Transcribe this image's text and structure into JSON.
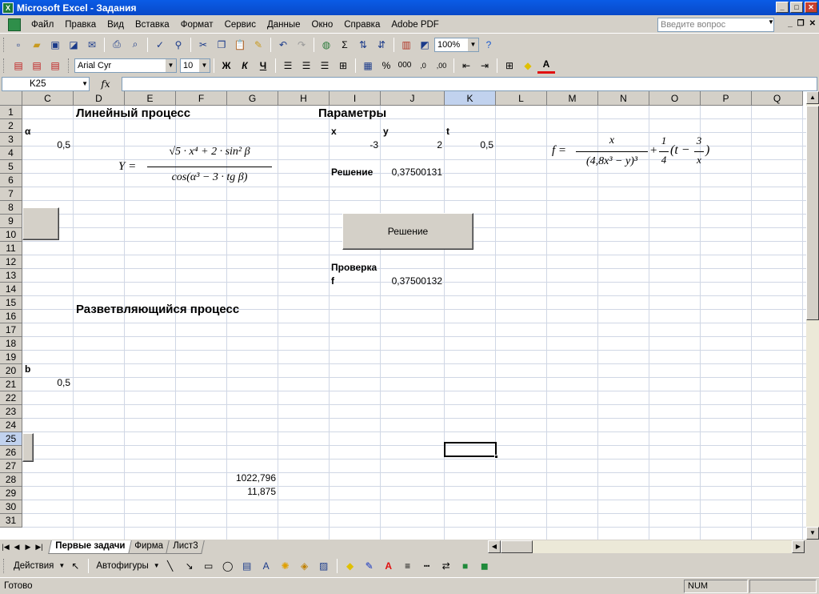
{
  "window": {
    "title": "Microsoft Excel - Задания",
    "app_icon": "excel-icon"
  },
  "menu": {
    "items": [
      "Файл",
      "Правка",
      "Вид",
      "Вставка",
      "Формат",
      "Сервис",
      "Данные",
      "Окно",
      "Справка",
      "Adobe PDF"
    ],
    "help_placeholder": "Введите вопрос"
  },
  "toolbar": {
    "zoom": "100%",
    "font_name": "Arial Cyr",
    "font_size": "10",
    "bold_label": "Ж",
    "italic_label": "К",
    "underline_label": "Ч",
    "percent_label": "%",
    "thousands_label": "000",
    "font_color_label": "A"
  },
  "formula_bar": {
    "name_box": "K25",
    "fx_label": "fx",
    "content": ""
  },
  "grid": {
    "columns": [
      "C",
      "D",
      "E",
      "F",
      "G",
      "H",
      "I",
      "J",
      "K",
      "L",
      "M",
      "N",
      "O",
      "P",
      "Q"
    ],
    "selected_column": "K",
    "rows": [
      "1",
      "2",
      "3",
      "4",
      "5",
      "6",
      "7",
      "8",
      "9",
      "10",
      "11",
      "12",
      "13",
      "14",
      "15",
      "16",
      "17",
      "18",
      "19",
      "20",
      "21",
      "22",
      "23",
      "24",
      "25",
      "26",
      "27",
      "28",
      "29",
      "30",
      "31"
    ],
    "selected_row": "25",
    "selected_cell": "K25"
  },
  "cells": {
    "linear_title": "Линейный процесс",
    "params_title": "Параметры",
    "alpha_label": "α",
    "alpha_value": "0,5",
    "x_label": "x",
    "y_label": "y",
    "t_label": "t",
    "x_value": "-3",
    "y_value": "2",
    "t_value": "0,5",
    "solution_label": "Решение",
    "solution_value": "0,37500131",
    "check_label": "Проверка",
    "f_label": "f",
    "f_value": "0,37500132",
    "branching_title": "Разветвляющийся процесс",
    "b_label": "b",
    "b_value": "0,5",
    "g27_value": "1022,796",
    "g28_value": "11,875"
  },
  "buttons": {
    "solve_label": "Решение"
  },
  "formulas": {
    "y_lhs": "Y =",
    "y_num": "√5 · x⁴ + 2 · sin² β",
    "y_den": "cos(α³ − 3 · tg β)",
    "f_lhs": "f =",
    "f_num": "x",
    "f_den": "(4,8x³ − y)³",
    "f_plus": "+",
    "f_q_num": "1",
    "f_q_den": "4",
    "f_tail": "(t −",
    "f_3x_num": "3",
    "f_3x_den": "x",
    "f_close": ")"
  },
  "sheet_tabs": [
    "Первые задачи",
    "Фирма",
    "Лист3"
  ],
  "active_sheet": "Первые задачи",
  "drawing": {
    "actions_label": "Действия",
    "autoshapes_label": "Автофигуры"
  },
  "status": {
    "text": "Готово",
    "num": "NUM"
  }
}
